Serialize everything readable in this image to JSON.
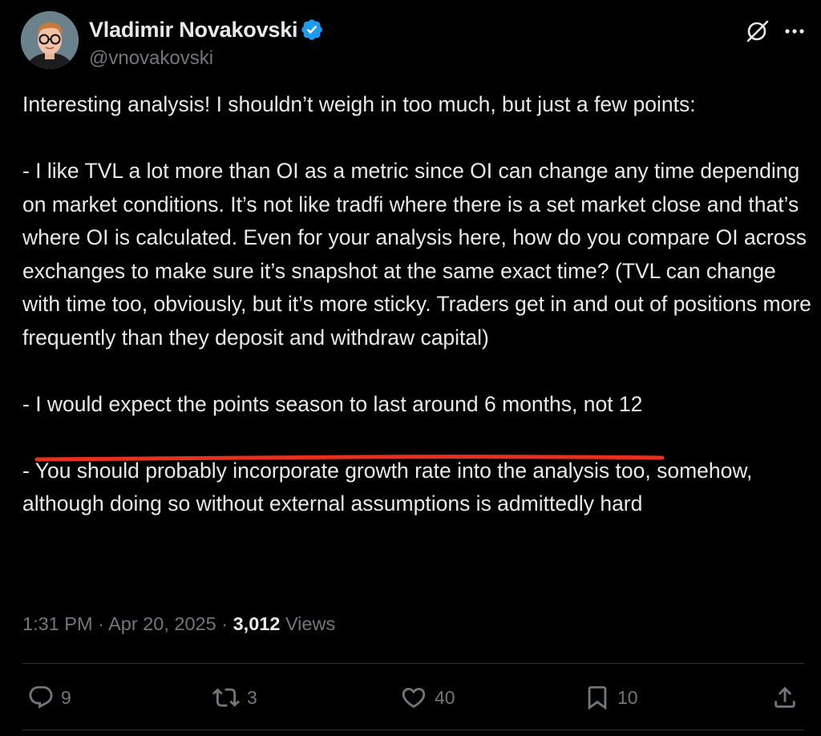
{
  "author": {
    "name": "Vladimir Novakovski",
    "handle": "@vnovakovski",
    "verified": true
  },
  "tweet": {
    "paragraphs": [
      "Interesting analysis!  I shouldn’t weigh in too much, but just a few points:",
      "- I like TVL a lot more than OI as a metric since OI can change any time depending on market conditions.  It’s not like tradfi where there is a set market close and that’s where OI is calculated.  Even for your analysis here, how do you compare OI across exchanges to make sure it’s snapshot at the same exact time? (TVL can change with time too, obviously, but it’s more sticky.  Traders get in and out of positions more frequently than they deposit and withdraw capital)",
      "- You should probably incorporate growth  rate into the analysis too, somehow, although doing so without external assumptions is admittedly hard"
    ],
    "highlighted_point": {
      "prefix": "- ",
      "underlined": "I would expect the points season to last around 6 months",
      "suffix": ", not 12"
    },
    "underline_color": "#e8301f"
  },
  "meta": {
    "time": "1:31 PM",
    "date": "Apr 20, 2025",
    "separator": "·",
    "views_count": "3,012",
    "views_label": "Views"
  },
  "actions": {
    "reply": {
      "icon": "reply-icon",
      "count": "9"
    },
    "retweet": {
      "icon": "retweet-icon",
      "count": "3"
    },
    "like": {
      "icon": "heart-icon",
      "count": "40"
    },
    "bookmark": {
      "icon": "bookmark-icon",
      "count": "10"
    },
    "share": {
      "icon": "share-icon"
    }
  },
  "colors": {
    "background": "#000000",
    "text": "#e7e9ea",
    "muted": "#71767b",
    "verified": "#1d9bf0",
    "divider": "#2f3336"
  }
}
